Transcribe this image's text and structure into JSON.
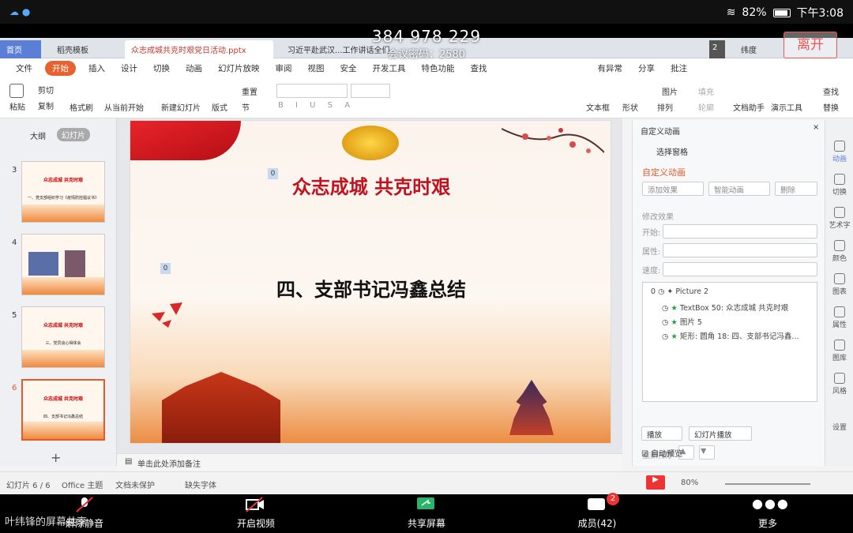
{
  "status": {
    "battery": "82%",
    "time": "下午3:08"
  },
  "meeting": {
    "id": "384 978 229",
    "password": "会议密码：2580",
    "leave": "离开"
  },
  "tabs": [
    {
      "label": "首页"
    },
    {
      "label": "稻壳模板"
    },
    {
      "label": "众志成城共克时艰党日活动.pptx"
    },
    {
      "label": "习近平赴武汉...工作讲话全们"
    }
  ],
  "tabs_right": {
    "count": "2",
    "user": "纬度"
  },
  "menu": [
    "文件",
    "开始",
    "插入",
    "设计",
    "切换",
    "动画",
    "幻灯片放映",
    "审阅",
    "视图",
    "安全",
    "开发工具",
    "特色功能",
    "查找"
  ],
  "menu_right": [
    "有异常",
    "分享",
    "批注"
  ],
  "ribbon": {
    "paste": "粘贴",
    "cut": "剪切",
    "copy": "复制",
    "format_painter": "格式刷",
    "play_from": "从当前开始",
    "new_slide": "新建幻灯片",
    "layout": "版式",
    "reset": "重置",
    "section": "节",
    "textbox": "文本框",
    "shape": "形状",
    "arrange": "排列",
    "picture": "图片",
    "fill": "填充",
    "outline": "轮廓",
    "doc_helper": "文档助手",
    "present_tool": "演示工具",
    "find": "查找",
    "replace": "替换"
  },
  "leftpanel": {
    "outline_tab": "大纲",
    "slides_tab": "幻灯片",
    "slides": [
      {
        "num": "3",
        "title": "众志成城 共克时艰",
        "text": "一、党支部组织学习《疫情防控倡议书》"
      },
      {
        "num": "4",
        "title": "",
        "text": ""
      },
      {
        "num": "5",
        "title": "众志成城 共克时艰",
        "text": "三、党员谈心得体会"
      },
      {
        "num": "6",
        "title": "众志成城 共克时艰",
        "text": "四、支部书记冯鑫总结"
      }
    ]
  },
  "slide": {
    "title": "众志成城 共克时艰",
    "subtitle": "四、支部书记冯鑫总结",
    "tag1": "0",
    "tag2": "0"
  },
  "notes": "单击此处添加备注",
  "rightpanel": {
    "header": "自定义动画",
    "select_pane": "选择窗格",
    "section": "自定义动画",
    "add_effect": "添加效果",
    "smart_anim": "智能动画",
    "delete": "删除",
    "modify": "修改效果",
    "start": "开始:",
    "property": "属性:",
    "speed": "速度:",
    "items": [
      {
        "idx": "0",
        "label": "Picture 2"
      },
      {
        "idx": "",
        "label": "TextBox 50: 众志成城 共克时艰"
      },
      {
        "idx": "",
        "label": "图片 5"
      },
      {
        "idx": "",
        "label": "矩形: 圆角 18: 四、支部书记冯鑫..."
      }
    ],
    "reorder": "重新排序",
    "play": "播放",
    "slideshow": "幻灯片播放",
    "autopreview": "自动预览"
  },
  "sidetools": [
    "动画",
    "切换",
    "艺术字",
    "颜色",
    "图表",
    "属性",
    "图库",
    "风格",
    "设置"
  ],
  "statusbottom": {
    "slide_count": "幻灯片 6 / 6",
    "theme": "Office 主题",
    "protect": "文档未保护",
    "font_missing": "缺失字体",
    "zoom": "80%"
  },
  "bottombar": {
    "mute": "解除静音",
    "video": "开启视频",
    "share": "共享屏幕",
    "members": "成员(42)",
    "more": "更多",
    "badge": "2"
  },
  "speaker": "叶纬锋的屏幕共享"
}
